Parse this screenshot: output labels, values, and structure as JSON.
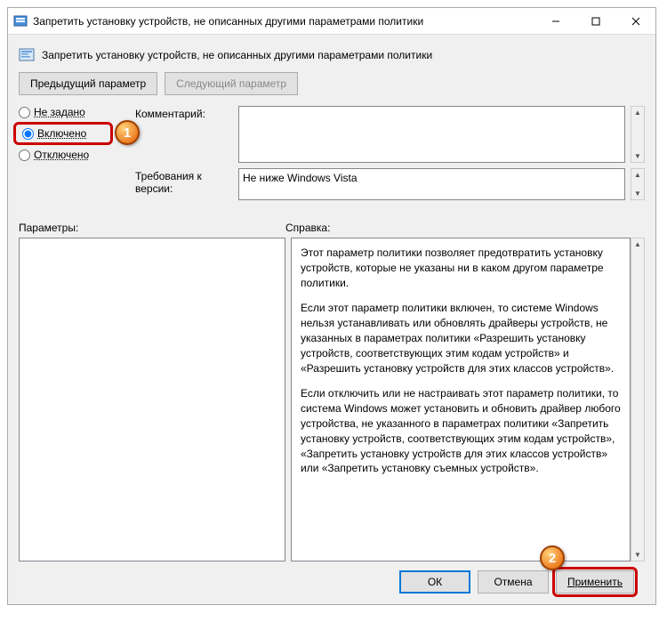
{
  "window": {
    "title": "Запретить установку устройств, не описанных другими параметрами политики"
  },
  "header": {
    "title": "Запретить установку устройств, не описанных другими параметрами политики"
  },
  "nav": {
    "prev": "Предыдущий параметр",
    "next": "Следующий параметр"
  },
  "radios": {
    "not_configured": "Не задано",
    "enabled": "Включено",
    "disabled": "Отключено"
  },
  "labels": {
    "comment": "Комментарий:",
    "requirements": "Требования к версии:",
    "parameters": "Параметры:",
    "help": "Справка:"
  },
  "fields": {
    "comment": "",
    "requirements": "Не ниже Windows Vista"
  },
  "help": {
    "p1": "Этот параметр политики позволяет предотвратить установку устройств, которые не указаны ни в каком другом параметре политики.",
    "p2": "Если этот параметр политики включен, то системе Windows нельзя устанавливать или обновлять драйверы устройств, не указанных в параметрах политики «Разрешить установку устройств, соответствующих этим кодам устройств» и «Разрешить установку устройств для этих классов устройств».",
    "p3": "Если отключить или не настраивать этот параметр политики, то система Windows может установить и обновить драйвер любого устройства, не указанного в параметрах политики «Запретить установку устройств, соответствующих этим кодам устройств», «Запретить установку устройств для этих классов устройств» или «Запретить установку съемных устройств»."
  },
  "footer": {
    "ok": "ОК",
    "cancel": "Отмена",
    "apply": "Применить"
  },
  "callouts": {
    "one": "1",
    "two": "2"
  }
}
